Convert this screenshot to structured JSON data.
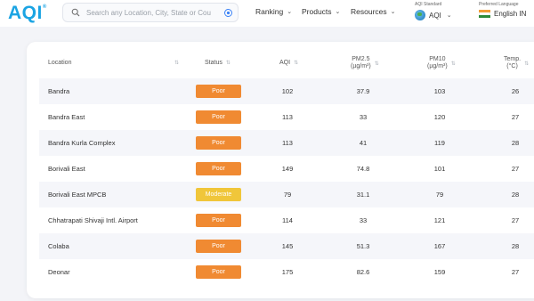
{
  "header": {
    "logo": "AQI",
    "logo_mark": "®",
    "search_placeholder": "Search any Location, City, State or Cou",
    "nav": [
      {
        "label": "Ranking"
      },
      {
        "label": "Products"
      },
      {
        "label": "Resources"
      }
    ],
    "standard_label": "AQI Standard",
    "standard_value": "AQI",
    "language_label": "Preferred Language",
    "language_value": "English IN"
  },
  "table": {
    "columns": {
      "location": "Location",
      "status": "Status",
      "aqi": "AQI",
      "pm25": "PM2.5",
      "pm25_unit": "(µg/m³)",
      "pm10": "PM10",
      "pm10_unit": "(µg/m³)",
      "temp": "Temp.",
      "temp_unit": "(°C)"
    },
    "rows": [
      {
        "location": "Bandra",
        "status": "Poor",
        "color": "#f08a32",
        "aqi": "102",
        "pm25": "37.9",
        "pm10": "103",
        "temp": "26"
      },
      {
        "location": "Bandra East",
        "status": "Poor",
        "color": "#f08a32",
        "aqi": "113",
        "pm25": "33",
        "pm10": "120",
        "temp": "27"
      },
      {
        "location": "Bandra Kurla Complex",
        "status": "Poor",
        "color": "#f08a32",
        "aqi": "113",
        "pm25": "41",
        "pm10": "119",
        "temp": "28"
      },
      {
        "location": "Borivali East",
        "status": "Poor",
        "color": "#f08a32",
        "aqi": "149",
        "pm25": "74.8",
        "pm10": "101",
        "temp": "27"
      },
      {
        "location": "Borivali East MPCB",
        "status": "Moderate",
        "color": "#f0c63a",
        "aqi": "79",
        "pm25": "31.1",
        "pm10": "79",
        "temp": "28"
      },
      {
        "location": "Chhatrapati Shivaji Intl. Airport",
        "status": "Poor",
        "color": "#f08a32",
        "aqi": "114",
        "pm25": "33",
        "pm10": "121",
        "temp": "27"
      },
      {
        "location": "Colaba",
        "status": "Poor",
        "color": "#f08a32",
        "aqi": "145",
        "pm25": "51.3",
        "pm10": "167",
        "temp": "28"
      },
      {
        "location": "Deonar",
        "status": "Poor",
        "color": "#f08a32",
        "aqi": "175",
        "pm25": "82.6",
        "pm10": "159",
        "temp": "27"
      }
    ]
  },
  "colors": {
    "brand": "#1ba4e3",
    "poor": "#f08a32",
    "moderate": "#f0c63a"
  },
  "icons": [
    "search-icon",
    "location-target-icon",
    "chevron-down-icon",
    "globe-icon",
    "india-flag-icon",
    "sort-icon"
  ]
}
